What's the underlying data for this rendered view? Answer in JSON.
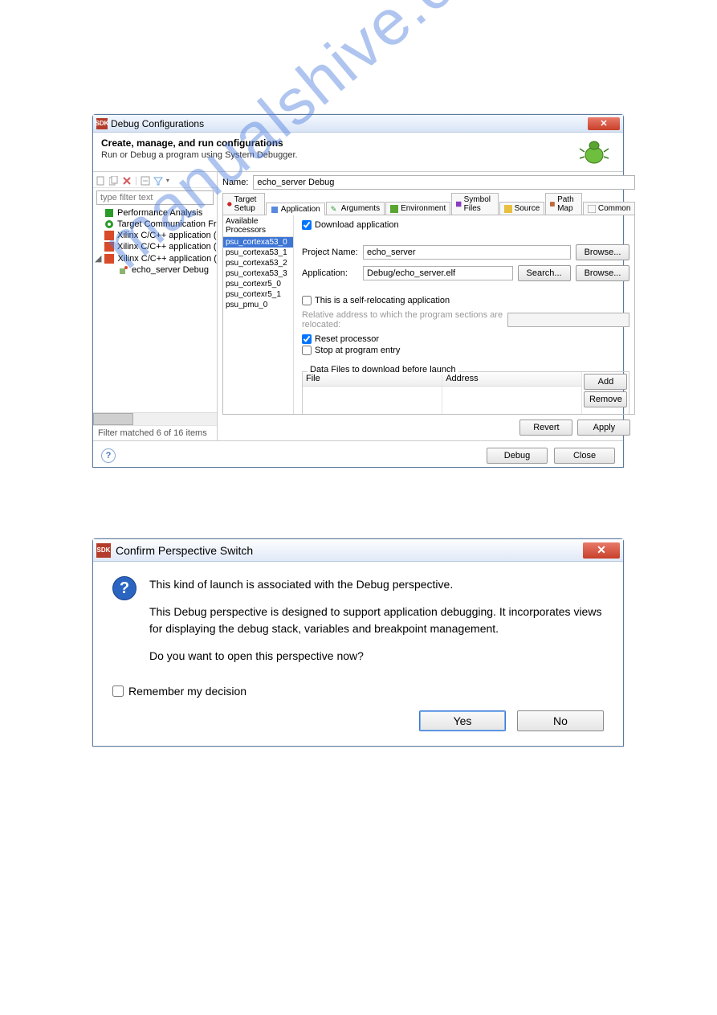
{
  "win1": {
    "title": "Debug Configurations",
    "banner_title": "Create, manage, and run configurations",
    "banner_sub": "Run or Debug a program using System Debugger.",
    "filter_placeholder": "type filter text",
    "tree": {
      "items": [
        "Performance Analysis",
        "Target Communication Framewo",
        "Xilinx C/C++ application (GDB)",
        "Xilinx C/C++ application (System",
        "Xilinx C/C++ application (System"
      ],
      "child": "echo_server Debug"
    },
    "filter_match": "Filter matched 6 of 16 items",
    "name_label": "Name:",
    "name_value": "echo_server Debug",
    "tabs": [
      "Target Setup",
      "Application",
      "Arguments",
      "Environment",
      "Symbol Files",
      "Source",
      "Path Map",
      "Common"
    ],
    "proc_header": "Available Processors",
    "processors": [
      "psu_cortexa53_0",
      "psu_cortexa53_1",
      "psu_cortexa53_2",
      "psu_cortexa53_3",
      "psu_cortexr5_0",
      "psu_cortexr5_1",
      "psu_pmu_0"
    ],
    "download_app": "Download application",
    "project_label": "Project Name:",
    "project_value": "echo_server",
    "app_label": "Application:",
    "app_value": "Debug/echo_server.elf",
    "browse": "Browse...",
    "search": "Search...",
    "self_reloc": "This is a self-relocating application",
    "reloc_note": "Relative address to which the program sections are relocated:",
    "reset_proc": "Reset processor",
    "stop_entry": "Stop at program entry",
    "datafiles_title": "Data Files to download before launch",
    "col_file": "File",
    "col_addr": "Address",
    "add": "Add",
    "remove": "Remove",
    "revert": "Revert",
    "apply": "Apply",
    "debug": "Debug",
    "close": "Close"
  },
  "win2": {
    "title": "Confirm Perspective Switch",
    "line1": "This kind of launch is associated with the Debug perspective.",
    "line2": "This Debug perspective is designed to support application debugging.  It incorporates views for displaying the debug stack, variables and breakpoint management.",
    "line3": "Do you want to open this perspective now?",
    "remember": "Remember my decision",
    "yes": "Yes",
    "no": "No"
  },
  "watermark": "manualshive.com"
}
